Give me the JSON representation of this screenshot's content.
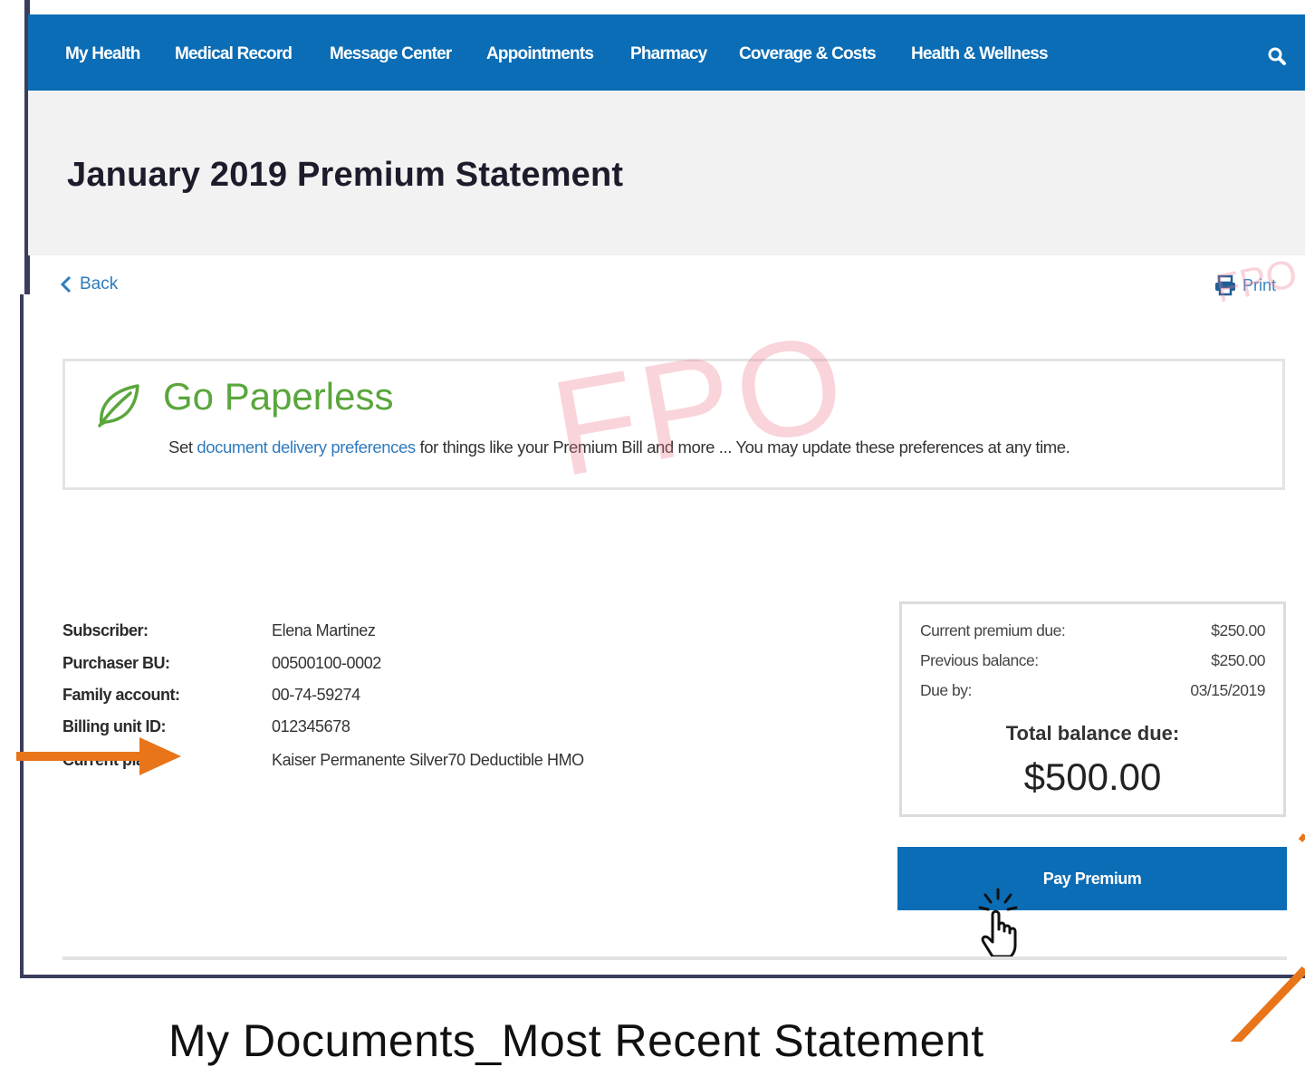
{
  "nav": {
    "items": [
      "My Health",
      "Medical Record",
      "Message Center",
      "Appointments",
      "Pharmacy",
      "Coverage & Costs",
      "Health & Wellness"
    ],
    "search_icon": "search-icon"
  },
  "page": {
    "title": "January 2019 Premium Statement"
  },
  "actions": {
    "back": "Back",
    "print": "Print"
  },
  "watermark": {
    "large": "FPO",
    "small": "FPO"
  },
  "paperless": {
    "title": "Go Paperless",
    "text_before": "Set",
    "link": "document delivery preferences",
    "text_after": "for things like your Premium Bill and more ... You may update these preferences at any time."
  },
  "details": {
    "rows": [
      {
        "label": "Subscriber:",
        "value": "Elena Martinez"
      },
      {
        "label": "Purchaser BU:",
        "value": "00500100-0002"
      },
      {
        "label": "Family account:",
        "value": "00-74-59274"
      },
      {
        "label": "Billing unit ID:",
        "value": "012345678"
      },
      {
        "label": "Current plan:",
        "value": "Kaiser Permanente Silver70 Deductible HMO"
      }
    ]
  },
  "balance": {
    "rows": [
      {
        "label": "Current premium due:",
        "value": "$250.00"
      },
      {
        "label": "Previous balance:",
        "value": "$250.00"
      },
      {
        "label": "Due by:",
        "value": "03/15/2019"
      }
    ],
    "total_label": "Total balance due:",
    "total_amount": "$500.00"
  },
  "pay_button": "Pay Premium",
  "caption": "My Documents_Most Recent Statement",
  "colors": {
    "brand_blue": "#0b6db5",
    "link_blue": "#2f7bbd",
    "leaf_green": "#5aa63c",
    "annotation_orange": "#e8751a"
  }
}
